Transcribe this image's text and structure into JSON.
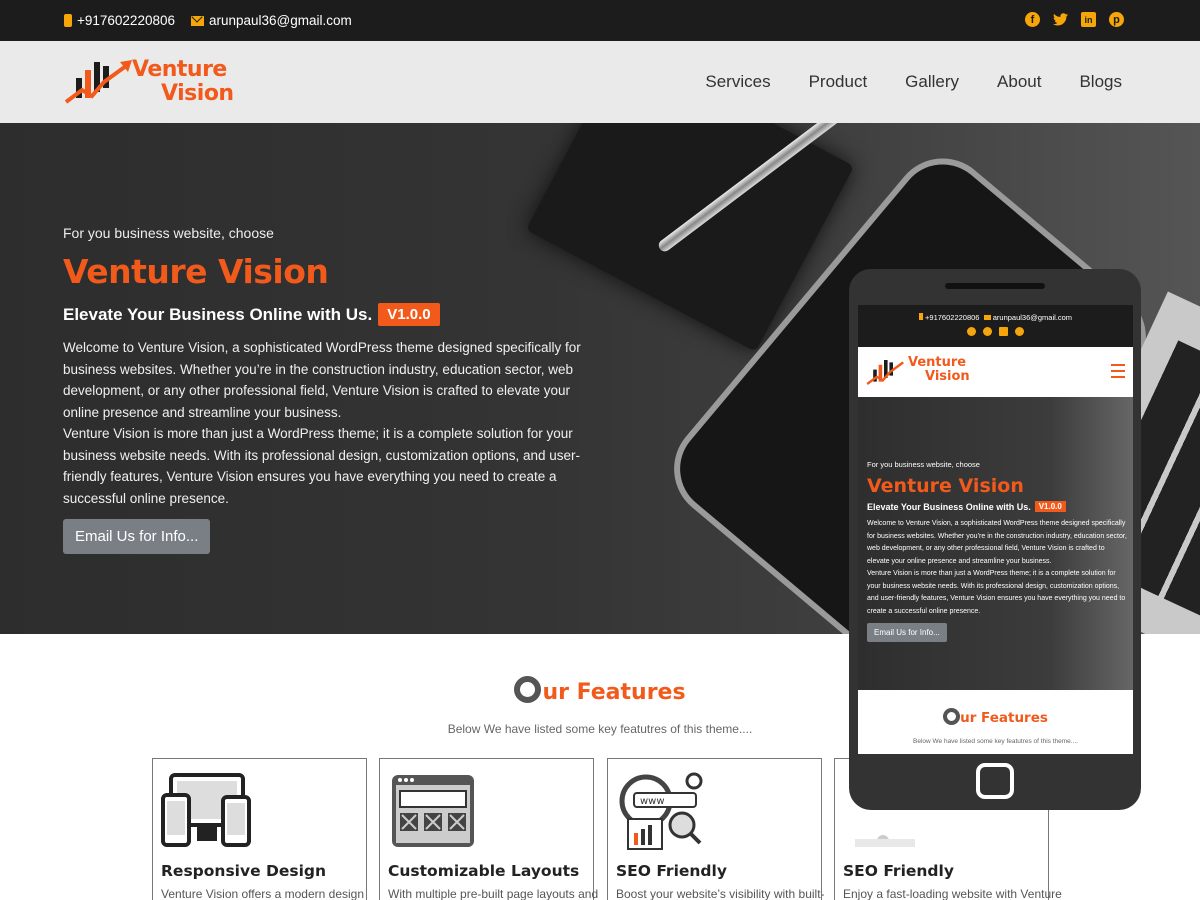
{
  "topbar": {
    "phone": "+917602220806",
    "email": "arunpaul36@gmail.com",
    "social": [
      "facebook-icon",
      "twitter-icon",
      "linkedin-icon",
      "pinterest-icon"
    ]
  },
  "header": {
    "logo_line1": "Venture",
    "logo_line2": "Vision",
    "nav": [
      "Services",
      "Product",
      "Gallery",
      "About",
      "Blogs"
    ]
  },
  "hero": {
    "subtitle": "For you business website, choose",
    "title": "Venture Vision",
    "tagline": "Elevate Your Business Online with Us.",
    "version": "V1.0.0",
    "description": "Welcome to Venture Vision, a sophisticated WordPress theme designed specifically for business websites. Whether you’re in the construction industry, education sector, web development, or any other professional field, Venture Vision is crafted to elevate your online presence and streamline your business.",
    "description2": "Venture Vision is more than just a WordPress theme; it is a complete solution for your business website needs. With its professional design, customization options, and user-friendly features, Venture Vision ensures you have everything you need to create a successful online presence.",
    "button": "Email Us for Info..."
  },
  "features": {
    "title_first": "O",
    "title_rest": "ur Features",
    "subtitle": "Below We have listed some key featutres of this theme....",
    "cards": [
      {
        "title": "Responsive Design",
        "desc": "Venture Vision offers a modern design"
      },
      {
        "title": "Customizable Layouts",
        "desc": "With multiple pre-built page layouts and"
      },
      {
        "title": "SEO Friendly",
        "desc": "Boost your website’s visibility with built-"
      },
      {
        "title": "SEO Friendly",
        "desc": "Enjoy a fast-loading website with Venture"
      }
    ]
  },
  "colors": {
    "accent": "#f25a1c",
    "topbar_bg": "#1c1c1c",
    "header_bg": "#eaeaea",
    "icon_accent": "#f6a609"
  }
}
